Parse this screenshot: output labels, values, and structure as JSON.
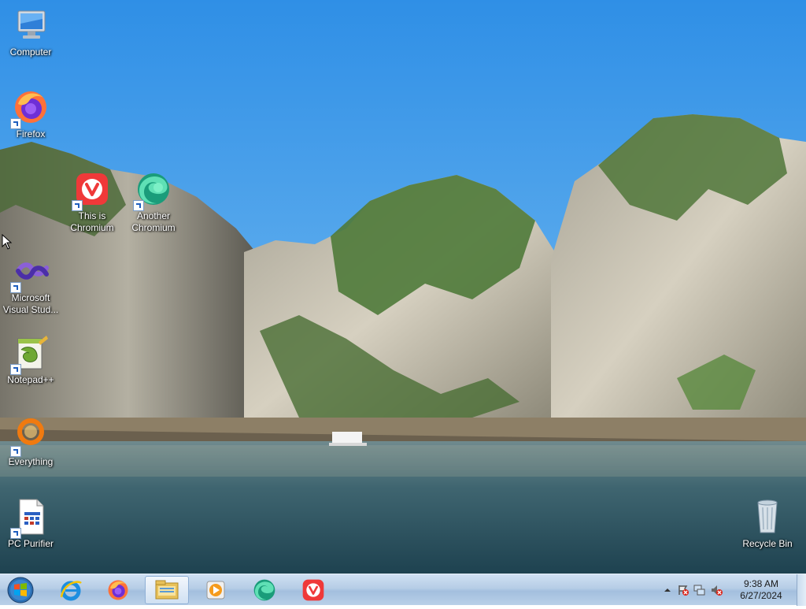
{
  "desktop": {
    "icons": [
      {
        "label": "Computer"
      },
      {
        "label": "Firefox"
      },
      {
        "label": "This is\nChromium"
      },
      {
        "label": "Another\nChromium"
      },
      {
        "label": "Microsoft\nVisual Stud..."
      },
      {
        "label": "Notepad++"
      },
      {
        "label": "Everything"
      },
      {
        "label": "PC Purifier"
      },
      {
        "label": "Recycle Bin"
      }
    ]
  },
  "taskbar": {
    "pinned": [
      "start-orb",
      "internet-explorer-icon",
      "firefox-icon",
      "file-explorer-icon",
      "media-player-icon",
      "edge-icon",
      "vivaldi-icon"
    ],
    "active_item": "file-explorer-icon",
    "clock": {
      "time": "9:38 AM",
      "date": "6/27/2024"
    },
    "tray_icons": [
      "show-hidden-icons",
      "action-center-icon",
      "network-icon",
      "volume-muted-icon"
    ]
  },
  "colors": {
    "sky": "#3f9be8",
    "taskbar": "#b6cde6",
    "vivaldi_red": "#ef3939",
    "firefox_orange": "#ff7139"
  }
}
